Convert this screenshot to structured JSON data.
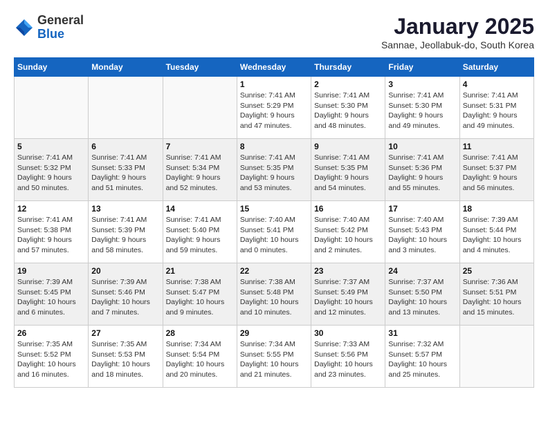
{
  "logo": {
    "general": "General",
    "blue": "Blue"
  },
  "header": {
    "month": "January 2025",
    "location": "Sannae, Jeollabuk-do, South Korea"
  },
  "days_of_week": [
    "Sunday",
    "Monday",
    "Tuesday",
    "Wednesday",
    "Thursday",
    "Friday",
    "Saturday"
  ],
  "weeks": [
    [
      {
        "day": "",
        "info": ""
      },
      {
        "day": "",
        "info": ""
      },
      {
        "day": "",
        "info": ""
      },
      {
        "day": "1",
        "info": "Sunrise: 7:41 AM\nSunset: 5:29 PM\nDaylight: 9 hours\nand 47 minutes."
      },
      {
        "day": "2",
        "info": "Sunrise: 7:41 AM\nSunset: 5:30 PM\nDaylight: 9 hours\nand 48 minutes."
      },
      {
        "day": "3",
        "info": "Sunrise: 7:41 AM\nSunset: 5:30 PM\nDaylight: 9 hours\nand 49 minutes."
      },
      {
        "day": "4",
        "info": "Sunrise: 7:41 AM\nSunset: 5:31 PM\nDaylight: 9 hours\nand 49 minutes."
      }
    ],
    [
      {
        "day": "5",
        "info": "Sunrise: 7:41 AM\nSunset: 5:32 PM\nDaylight: 9 hours\nand 50 minutes."
      },
      {
        "day": "6",
        "info": "Sunrise: 7:41 AM\nSunset: 5:33 PM\nDaylight: 9 hours\nand 51 minutes."
      },
      {
        "day": "7",
        "info": "Sunrise: 7:41 AM\nSunset: 5:34 PM\nDaylight: 9 hours\nand 52 minutes."
      },
      {
        "day": "8",
        "info": "Sunrise: 7:41 AM\nSunset: 5:35 PM\nDaylight: 9 hours\nand 53 minutes."
      },
      {
        "day": "9",
        "info": "Sunrise: 7:41 AM\nSunset: 5:35 PM\nDaylight: 9 hours\nand 54 minutes."
      },
      {
        "day": "10",
        "info": "Sunrise: 7:41 AM\nSunset: 5:36 PM\nDaylight: 9 hours\nand 55 minutes."
      },
      {
        "day": "11",
        "info": "Sunrise: 7:41 AM\nSunset: 5:37 PM\nDaylight: 9 hours\nand 56 minutes."
      }
    ],
    [
      {
        "day": "12",
        "info": "Sunrise: 7:41 AM\nSunset: 5:38 PM\nDaylight: 9 hours\nand 57 minutes."
      },
      {
        "day": "13",
        "info": "Sunrise: 7:41 AM\nSunset: 5:39 PM\nDaylight: 9 hours\nand 58 minutes."
      },
      {
        "day": "14",
        "info": "Sunrise: 7:41 AM\nSunset: 5:40 PM\nDaylight: 9 hours\nand 59 minutes."
      },
      {
        "day": "15",
        "info": "Sunrise: 7:40 AM\nSunset: 5:41 PM\nDaylight: 10 hours\nand 0 minutes."
      },
      {
        "day": "16",
        "info": "Sunrise: 7:40 AM\nSunset: 5:42 PM\nDaylight: 10 hours\nand 2 minutes."
      },
      {
        "day": "17",
        "info": "Sunrise: 7:40 AM\nSunset: 5:43 PM\nDaylight: 10 hours\nand 3 minutes."
      },
      {
        "day": "18",
        "info": "Sunrise: 7:39 AM\nSunset: 5:44 PM\nDaylight: 10 hours\nand 4 minutes."
      }
    ],
    [
      {
        "day": "19",
        "info": "Sunrise: 7:39 AM\nSunset: 5:45 PM\nDaylight: 10 hours\nand 6 minutes."
      },
      {
        "day": "20",
        "info": "Sunrise: 7:39 AM\nSunset: 5:46 PM\nDaylight: 10 hours\nand 7 minutes."
      },
      {
        "day": "21",
        "info": "Sunrise: 7:38 AM\nSunset: 5:47 PM\nDaylight: 10 hours\nand 9 minutes."
      },
      {
        "day": "22",
        "info": "Sunrise: 7:38 AM\nSunset: 5:48 PM\nDaylight: 10 hours\nand 10 minutes."
      },
      {
        "day": "23",
        "info": "Sunrise: 7:37 AM\nSunset: 5:49 PM\nDaylight: 10 hours\nand 12 minutes."
      },
      {
        "day": "24",
        "info": "Sunrise: 7:37 AM\nSunset: 5:50 PM\nDaylight: 10 hours\nand 13 minutes."
      },
      {
        "day": "25",
        "info": "Sunrise: 7:36 AM\nSunset: 5:51 PM\nDaylight: 10 hours\nand 15 minutes."
      }
    ],
    [
      {
        "day": "26",
        "info": "Sunrise: 7:35 AM\nSunset: 5:52 PM\nDaylight: 10 hours\nand 16 minutes."
      },
      {
        "day": "27",
        "info": "Sunrise: 7:35 AM\nSunset: 5:53 PM\nDaylight: 10 hours\nand 18 minutes."
      },
      {
        "day": "28",
        "info": "Sunrise: 7:34 AM\nSunset: 5:54 PM\nDaylight: 10 hours\nand 20 minutes."
      },
      {
        "day": "29",
        "info": "Sunrise: 7:34 AM\nSunset: 5:55 PM\nDaylight: 10 hours\nand 21 minutes."
      },
      {
        "day": "30",
        "info": "Sunrise: 7:33 AM\nSunset: 5:56 PM\nDaylight: 10 hours\nand 23 minutes."
      },
      {
        "day": "31",
        "info": "Sunrise: 7:32 AM\nSunset: 5:57 PM\nDaylight: 10 hours\nand 25 minutes."
      },
      {
        "day": "",
        "info": ""
      }
    ]
  ]
}
